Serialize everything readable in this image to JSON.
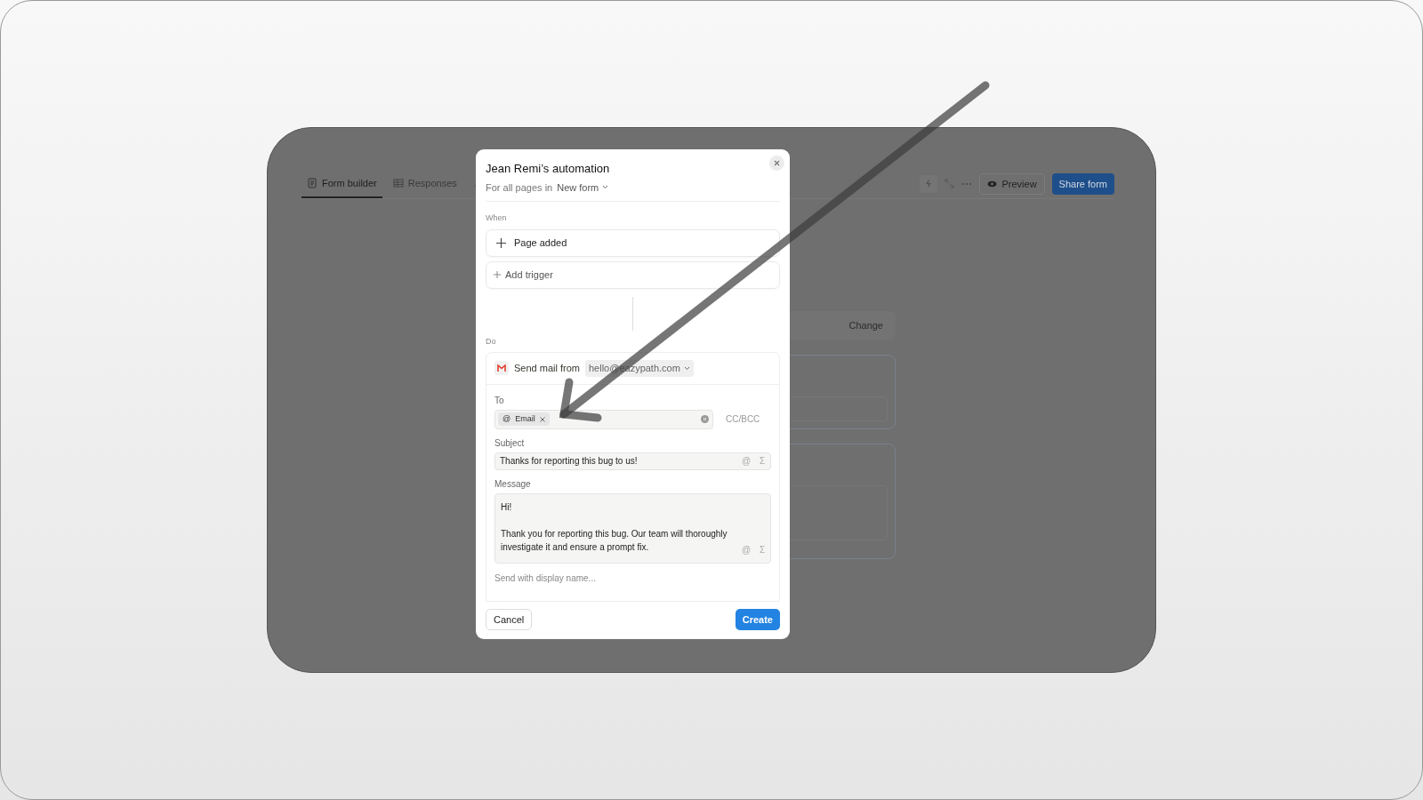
{
  "background_app": {
    "tabs": [
      {
        "label": "Form builder",
        "selected": true
      },
      {
        "label": "Responses",
        "selected": false
      }
    ],
    "toolbar": {
      "preview": "Preview",
      "share": "Share form"
    },
    "change_button": "Change"
  },
  "dialog": {
    "title": "Jean Remi’s automation",
    "scope_label": "For all pages in",
    "scope_value": "New form",
    "when_label": "When",
    "trigger": "Page added",
    "add_trigger": "Add trigger",
    "do_label": "Do",
    "action": {
      "label": "Send mail from",
      "sender": "hello@eazypath.com"
    },
    "to_label": "To",
    "to_chips": [
      {
        "prefix": "@",
        "label": "Email"
      }
    ],
    "cc_bcc": "CC/BCC",
    "subject_label": "Subject",
    "subject": "Thanks for reporting this bug to us!",
    "subject_tools": [
      "@",
      "Σ"
    ],
    "message_label": "Message",
    "message": "Hi!\n\nThank you for reporting this bug. Our team will thoroughly investigate it and ensure a prompt fix.",
    "message_tools": [
      "@",
      "Σ"
    ],
    "display_name": "Send with display name...",
    "cancel": "Cancel",
    "create": "Create"
  }
}
